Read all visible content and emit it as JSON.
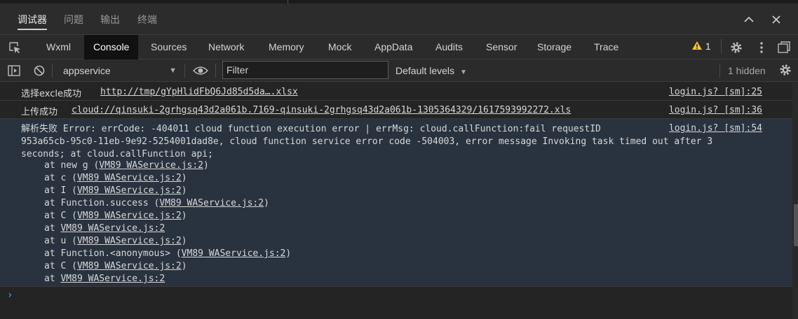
{
  "panel_tabs": [
    "调试器",
    "问题",
    "输出",
    "终端"
  ],
  "devtools_tabs": [
    "Wxml",
    "Console",
    "Sources",
    "Network",
    "Memory",
    "Mock",
    "AppData",
    "Audits",
    "Sensor",
    "Storage",
    "Trace"
  ],
  "active_devtools_tab": "Console",
  "warnings": {
    "count": "1"
  },
  "toolbar": {
    "context": "appservice",
    "filter_placeholder": "Filter",
    "levels": "Default levels",
    "hidden": "1 hidden"
  },
  "logs": {
    "row1": {
      "label": "选择excle成功",
      "link": "http://tmp/gYpHlidFbQ6Jd85d5da….xlsx",
      "source": "login.js? [sm]:25"
    },
    "row2": {
      "label": "上传成功",
      "link": "cloud://qinsuki-2grhgsq43d2a061b.7169-qinsuki-2grhgsq43d2a061b-1305364329/1617593992272.xls",
      "source": "login.js? [sm]:36"
    },
    "error": {
      "label": "解析失败",
      "message": "Error: errCode: -404011 cloud function execution error | errMsg: cloud.callFunction:fail requestID",
      "message2": "953a65cb-95c0-11eb-9e92-5254001dad8e, cloud function service error code -504003, error message Invoking task timed out after 3",
      "message3": "seconds; at cloud.callFunction api;",
      "source": "login.js? [sm]:54",
      "stack": [
        {
          "prefix": "at new g (",
          "link": "VM89 WAService.js:2",
          "suffix": ")"
        },
        {
          "prefix": "at c (",
          "link": "VM89 WAService.js:2",
          "suffix": ")"
        },
        {
          "prefix": "at I (",
          "link": "VM89 WAService.js:2",
          "suffix": ")"
        },
        {
          "prefix": "at Function.success (",
          "link": "VM89 WAService.js:2",
          "suffix": ")"
        },
        {
          "prefix": "at C (",
          "link": "VM89 WAService.js:2",
          "suffix": ")"
        },
        {
          "prefix": "at ",
          "link": "VM89 WAService.js:2",
          "suffix": ""
        },
        {
          "prefix": "at u (",
          "link": "VM89 WAService.js:2",
          "suffix": ")"
        },
        {
          "prefix": "at Function.<anonymous> (",
          "link": "VM89 WAService.js:2",
          "suffix": ")"
        },
        {
          "prefix": "at C (",
          "link": "VM89 WAService.js:2",
          "suffix": ")"
        },
        {
          "prefix": "at ",
          "link": "VM89 WAService.js:2",
          "suffix": ""
        }
      ]
    }
  },
  "prompt_symbol": "›",
  "colors": {
    "accent": "#4aa3ff",
    "warning": "#f2c230",
    "error_bg": "#29323f"
  }
}
